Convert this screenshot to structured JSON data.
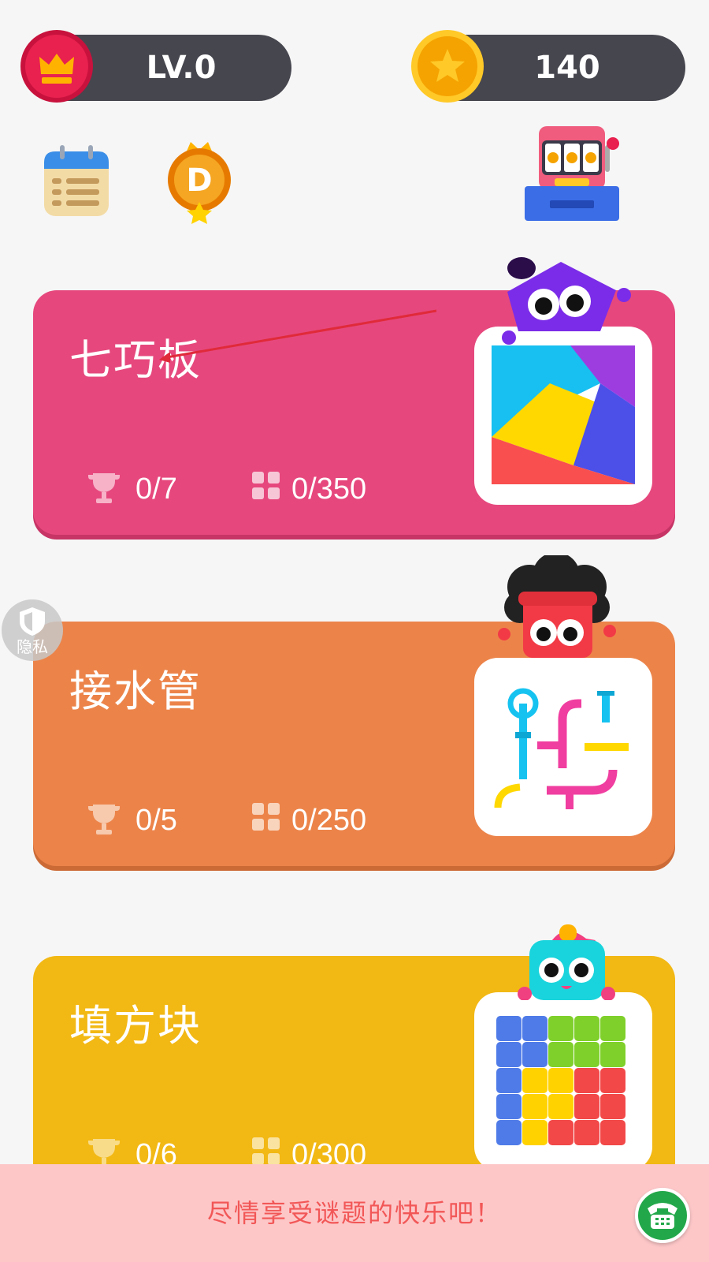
{
  "header": {
    "level": {
      "label": "LV.0",
      "icon": "crown-icon",
      "color": "#e8214f"
    },
    "coins": {
      "value": "140",
      "icon": "star-coin-icon",
      "color": "#f5b400"
    }
  },
  "shortcuts": [
    {
      "icon": "calendar-list-icon"
    },
    {
      "icon": "d-medal-icon",
      "letter": "D"
    },
    {
      "icon": "slot-machine-icon"
    }
  ],
  "games": [
    {
      "title": "七巧板",
      "trophies": "0/7",
      "levels": "0/350",
      "color": "#e6487d",
      "shade": "#c73466"
    },
    {
      "title": "接水管",
      "trophies": "0/5",
      "levels": "0/250",
      "color": "#ec844a",
      "shade": "#cc6a36"
    },
    {
      "title": "填方块",
      "trophies": "0/6",
      "levels": "0/300",
      "color": "#f2b814",
      "shade": "#d49d0c"
    }
  ],
  "privacy": {
    "label": "隐私"
  },
  "footer": {
    "message": "尽情享受谜题的快乐吧！"
  }
}
